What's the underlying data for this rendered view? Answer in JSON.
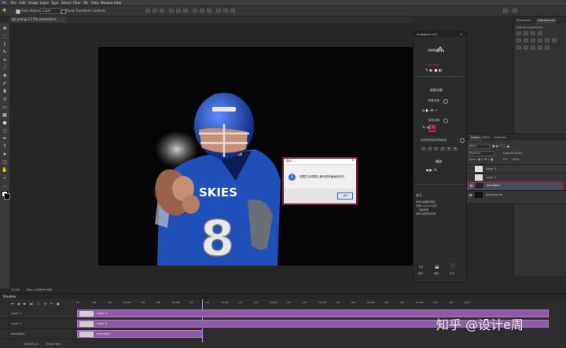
{
  "menubar": {
    "logo": "Ps",
    "items": [
      "File",
      "Edit",
      "Image",
      "Layer",
      "Type",
      "Select",
      "Filter",
      "3D",
      "View",
      "Window",
      "Help"
    ]
  },
  "options": {
    "auto_select": "Auto-Select:",
    "layer_value": "Layer",
    "show_transform": "Show Transform Controls"
  },
  "document": {
    "tab_title": "选(.psd @ 12.5% (animation, RGB/8) *"
  },
  "plugin_panel": {
    "title": "Animation v1.1",
    "brand": "动画精灵",
    "brand_sub": "云端工作室",
    "section_convert": "转换动画",
    "label_mode": "图像效果",
    "label_frames": "帧状效果",
    "label_bounce": "快速制作前后时间轴动画",
    "nums": [
      "1",
      "2",
      "3",
      "4",
      "5",
      "6"
    ],
    "section_play": "播放",
    "about_title": "关于",
    "about_lines": [
      "作者:动画精灵团队",
      "设置Animation显示",
      "... 动画效果",
      "其他     动画转动效果"
    ],
    "bottom_labels": [
      "选项",
      "保存",
      "关于"
    ]
  },
  "right_panel": {
    "tabs": [
      "Properties",
      "Adjustments"
    ],
    "add_label": "Add an adjustment"
  },
  "layers_panel": {
    "tabs": [
      "Layers",
      "Paths",
      "Channels"
    ],
    "kind": "Kind",
    "blend": "Normal",
    "opacity_label": "Opacity:",
    "opacity_value": "100%",
    "lock_label": "Lock:",
    "fill_label": "Fill:",
    "fill_value": "100%",
    "layers": [
      {
        "name": "Layer 1",
        "selected": false
      },
      {
        "name": "Layer 2",
        "selected": false
      },
      {
        "name": "animation",
        "selected": true
      },
      {
        "name": "Background",
        "selected": false
      }
    ]
  },
  "dialog": {
    "title": "提示",
    "message": "设置生长效果后,移动到前面画布进行",
    "ok": "OK"
  },
  "status": {
    "zoom": "12.5%",
    "doc": "Doc: 4.50M/9.00M"
  },
  "timeline": {
    "title": "Timeline",
    "time": "0;00;00;22",
    "fps": "(30.00 fps)",
    "ruler": [
      "00",
      "10f",
      "20f",
      "01:00f",
      "10f",
      "20f",
      "02:00f",
      "10f",
      "20f",
      "03:00f",
      "10f",
      "20f",
      "04:00f",
      "10f",
      "20f",
      "05:00f",
      "10f",
      "20f",
      "06:00f",
      "10f",
      "20f",
      "07:00f",
      "10f",
      "20f",
      "08:0"
    ],
    "tracks": [
      {
        "name": "Layer 1",
        "clip": "Layer 1"
      },
      {
        "name": "Layer 2",
        "clip": "Layer 2"
      },
      {
        "name": "animation",
        "clip": "animation"
      }
    ]
  },
  "watermark": "知乎 @设计e周",
  "colors": {
    "accent": "#8e5aa6",
    "dialog_border": "#7a1f3a",
    "jersey_blue": "#1f4fb8"
  }
}
